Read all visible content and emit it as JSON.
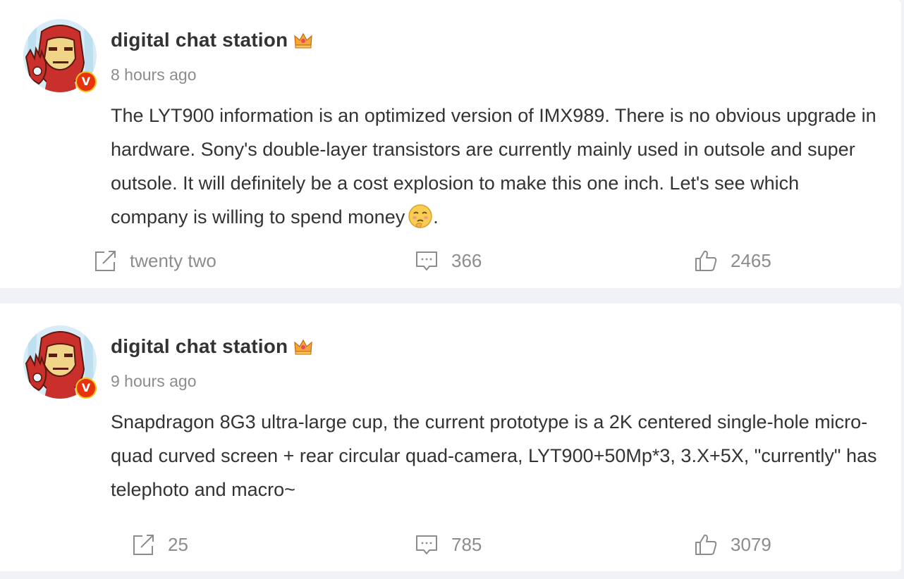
{
  "posts": [
    {
      "username": "digital chat station",
      "time": "8 hours ago",
      "text": "The LYT900 information is an optimized version of IMX989. There is no obvious upgrade in hardware. Sony's double-layer transistors are currently mainly used in outsole and super outsole. It will definitely be a cost explosion to make this one inch. Let's see which company is willing to spend money",
      "text_end": ".",
      "badge": "V",
      "shares": "twenty two",
      "comments": "366",
      "likes": "2465"
    },
    {
      "username": "digital chat station",
      "time": "9 hours ago",
      "text": "Snapdragon 8G3 ultra-large cup, the current prototype is a 2K centered single-hole micro-quad curved screen + rear circular quad-camera, LYT900+50Mp*3, 3.X+5X, \"currently\" has telephoto and macro~",
      "badge": "V",
      "shares": "25",
      "comments": "785",
      "likes": "3079"
    }
  ],
  "icons": {
    "avatar": "iron-man-avatar",
    "badge": "verified-v-icon",
    "crown": "crown-icon",
    "emoji": "smug-emoji-icon",
    "share": "share-icon",
    "comment": "comment-icon",
    "like": "thumbs-up-icon"
  },
  "colors": {
    "background": "#f1f2f5",
    "card": "#ffffff",
    "text": "#333333",
    "muted": "#8c8c8c",
    "badge": "#e8340e",
    "crown": "#f0a030"
  }
}
